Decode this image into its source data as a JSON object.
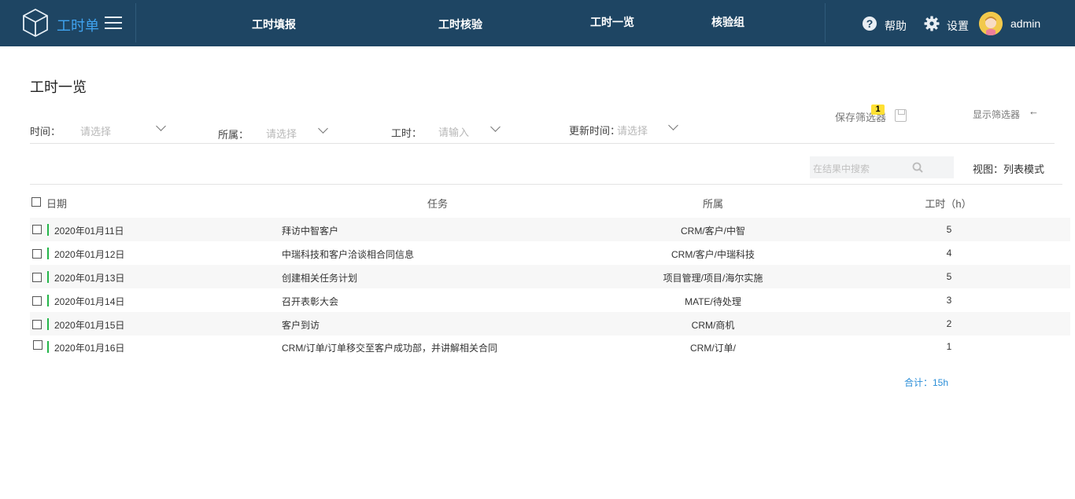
{
  "header": {
    "brand": "工时单",
    "nav": [
      "工时填报",
      "工时核验",
      "工时一览",
      "核验组"
    ],
    "help": "帮助",
    "settings": "设置",
    "user": "admin"
  },
  "page": {
    "title": "工时一览",
    "save_filter": "保存筛选器",
    "filter_badge": "1",
    "show_filter": "显示筛选器",
    "arrow": "←",
    "view_mode": "视图：列表模式"
  },
  "filters": [
    {
      "label": "时间：",
      "placeholder": "请选择"
    },
    {
      "label": "所属：",
      "placeholder": "请选择"
    },
    {
      "label": "工时：",
      "placeholder": "请输入"
    },
    {
      "label": "更新时间：",
      "placeholder": "请选择"
    }
  ],
  "search": {
    "placeholder": "在结果中搜索"
  },
  "table": {
    "columns": [
      "日期",
      "任务",
      "所属",
      "工时（h）"
    ],
    "rows": [
      {
        "date": "2020年01月11日",
        "task": "拜访中智客户",
        "owner": "CRM/客户/中智",
        "hours": "5"
      },
      {
        "date": "2020年01月12日",
        "task": "中瑞科技和客户洽谈相合同信息",
        "owner": "CRM/客户/中瑞科技",
        "hours": "4"
      },
      {
        "date": "2020年01月13日",
        "task": "创建相关任务计划",
        "owner": "项目管理/项目/海尔实施",
        "hours": "5"
      },
      {
        "date": "2020年01月14日",
        "task": "召开表彰大会",
        "owner": "MATE/待处理",
        "hours": "3"
      },
      {
        "date": "2020年01月15日",
        "task": "客户到访",
        "owner": "CRM/商机",
        "hours": "2"
      },
      {
        "date": "2020年01月16日",
        "task": "CRM/订单/订单移交至客户成功部，并讲解相关合同",
        "owner": "CRM/订单/",
        "hours": "1"
      }
    ],
    "total": "合计：15h"
  }
}
